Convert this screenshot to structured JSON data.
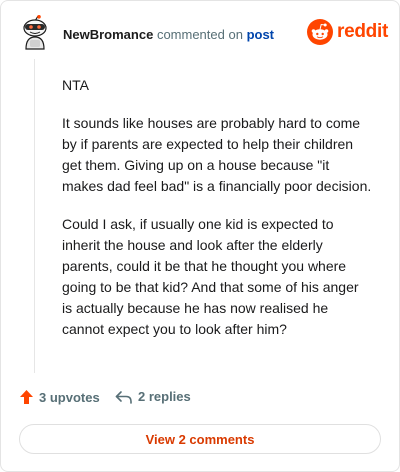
{
  "header": {
    "username": "NewBromance",
    "action_text": "commented on",
    "post_link": "post",
    "logo_text": "reddit",
    "icons": [
      "avatar-icon",
      "reddit-alien-icon"
    ]
  },
  "comment": {
    "paragraphs": [
      "NTA",
      "It sounds like houses are probably hard to come by if parents are expected to help their children get them. Giving up on a house because \"it makes dad feel bad\" is a financially poor decision.",
      "Could I ask, if usually one kid is expected to inherit the house and look after the elderly parents, could it be that he thought you where going to be that kid? And that some of his anger is actually because he has now realised he cannot expect you to look after him?"
    ]
  },
  "footer": {
    "upvotes_label": "3 upvotes",
    "replies_label": "2 replies",
    "view_comments_label": "View 2 comments"
  },
  "colors": {
    "brand": "#ff4500",
    "upvote": "#ff4500",
    "link": "#0045ac",
    "muted": "#576f76",
    "view_button_text": "#d93a00"
  }
}
